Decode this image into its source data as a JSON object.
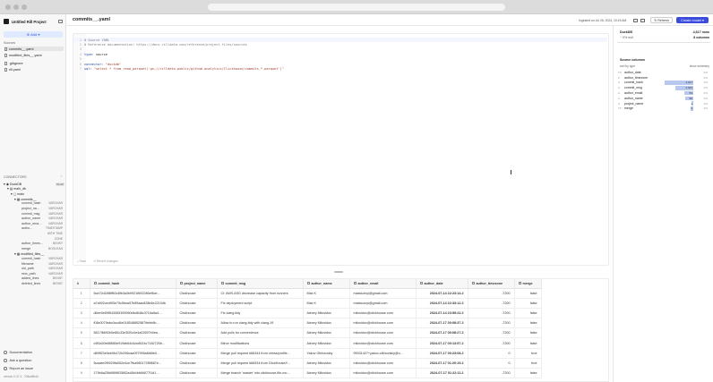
{
  "project": {
    "name": "Untitled Rill Project"
  },
  "sidebar": {
    "add_label": "Add",
    "sources_header": "Sources",
    "files": [
      "commits__.yaml",
      "modified_files__.yaml",
      ".gitignore",
      "rill.yaml"
    ],
    "connectors_header": "CONNECTORS",
    "connector": {
      "name": "DuckDB",
      "badge": "OLAP",
      "database": "main_db",
      "schema": "main"
    },
    "tables": [
      {
        "name": "commits__",
        "columns": [
          {
            "name": "commit_hash",
            "type": "VARCHAR"
          },
          {
            "name": "project_na…",
            "type": "VARCHAR"
          },
          {
            "name": "commit_msg",
            "type": "VARCHAR"
          },
          {
            "name": "author_name",
            "type": "VARCHAR"
          },
          {
            "name": "author_ema…",
            "type": "VARCHAR"
          },
          {
            "name": "autho…",
            "type": "TIMESTAMP"
          },
          {
            "name": "",
            "type": "WITH TIME"
          },
          {
            "name": "",
            "type": "ZONE"
          },
          {
            "name": "author_times…",
            "type": "BIGINT"
          },
          {
            "name": "merge",
            "type": "BOOLEAN"
          }
        ]
      },
      {
        "name": "modified_files__",
        "columns": [
          {
            "name": "commit_hash",
            "type": "VARCHAR"
          },
          {
            "name": "filename",
            "type": "VARCHAR"
          },
          {
            "name": "old_path",
            "type": "VARCHAR"
          },
          {
            "name": "new_path",
            "type": "VARCHAR"
          },
          {
            "name": "added_lines",
            "type": "BIGINT"
          },
          {
            "name": "deleted_lines",
            "type": "BIGINT"
          }
        ]
      }
    ],
    "footer": [
      "Documentation",
      "Ask a question",
      "Report an issue"
    ],
    "version": "version 0.47.4 - 708ad8b4d"
  },
  "header": {
    "title": "commits__.yaml",
    "saved": "Ingested on Jul 26, 2024, 10:15 AM",
    "refresh_label": "Refresh",
    "create_label": "Create model"
  },
  "editor": {
    "lines": [
      {
        "n": "1",
        "parts": [
          {
            "c": "cm",
            "t": "# Source YAML"
          }
        ]
      },
      {
        "n": "2",
        "parts": [
          {
            "c": "cm",
            "t": "# Reference documentation: https://docs.rilldata.com/reference/project-files/sources"
          }
        ]
      },
      {
        "n": "3",
        "parts": []
      },
      {
        "n": "4",
        "parts": [
          {
            "c": "kw",
            "t": "type: "
          },
          {
            "c": "",
            "t": "source"
          }
        ]
      },
      {
        "n": "5",
        "parts": []
      },
      {
        "n": "6",
        "parts": [
          {
            "c": "kw",
            "t": "connector: "
          },
          {
            "c": "str",
            "t": "\"duckdb\""
          }
        ]
      },
      {
        "n": "7",
        "parts": [
          {
            "c": "kw",
            "t": "sql: "
          },
          {
            "c": "str",
            "t": "\"select * from read_parquet('gs://rilldata-public/github-analytics/Clickhouse/commits_*.parquet')\""
          }
        ]
      }
    ],
    "save_label": "Save",
    "revert_label": "Revert changes"
  },
  "table": {
    "columns": [
      "#",
      "commit_hash",
      "project_name",
      "commit_msg",
      "author_name",
      "author_email",
      "author_date",
      "author_timezone",
      "merge"
    ],
    "rows": [
      [
        "1",
        "5ca72d18f8ff63c6fb3a3b9921f692286ef6ce…",
        "Clickhouse",
        "CI: AWS ASG decrease capacity from runners",
        "Max K",
        "maxkuznyi@gmail.com",
        "2024-07-14 22:23:14.2",
        "-7200",
        "false"
      ],
      [
        "2",
        "a7a902ced9f3e75c5bea57b89aac828b6e2210db",
        "Clickhouse",
        "Fix deployment script",
        "Max K",
        "maxkuznyi@gmail.com",
        "2024-07-14 22:33:12.2",
        "-7200",
        "false"
      ],
      [
        "3",
        "d6ee0e59f543065394960dbd648c3716a5a4…",
        "Clickhouse",
        "Fix clang-tidy",
        "Alexey Milovidov",
        "milovidov@clickhouse.com",
        "2024-07-14 23:59:22.2",
        "-7200",
        "false"
      ],
      [
        "4",
        "f08c0079abc0ccd6e0185488925879ebb6b…",
        "Clickhouse",
        "Allow to run clang-tidy with clang-19",
        "Alexey Milovidov",
        "milovidov@clickhouse.com",
        "2024-07-17 00:08:37.2",
        "-7200",
        "false"
      ],
      [
        "5",
        "5817f6692b0e80c33e3f20c0e4a02697b0ea…",
        "Clickhouse",
        "Add pulls for convenience",
        "Alexey Milovidov",
        "milovidov@clickhouse.com",
        "2024-07-17 00:08:27.2",
        "-7200",
        "false"
      ],
      [
        "6",
        "c9f3a30e88580e919db64d1dc8024c7182725b…",
        "Clickhouse",
        "Minor modifications",
        "Alexey Milovidov",
        "milovidov@clickhouse.com",
        "2024-07-17 00:13:57.2",
        "-7200",
        "false"
      ],
      [
        "7",
        "d89ff23e5eb0b472b296caa097995a6b6fe0…",
        "Clickhouse",
        "Merge pull request #66344 from ohriss/profile…",
        "Yakov Olkhovskiy",
        "99031427+yakov-olkhovskiy@u…",
        "2024-07-17 00:23:08.2",
        "0",
        "true"
      ],
      [
        "8",
        "5caaee0f9025fa052e4ce7fba980173f5f887e…",
        "Clickhouse",
        "Merge pull request #66534 from ClickHouse/f…",
        "Alexey Milovidov",
        "milovidov@clickhouse.com",
        "2024-07-17 01:20:15.2",
        "0",
        "true"
      ],
      [
        "9",
        "179b6a25fd9896f25f82a48b4bb6b577f1d1…",
        "Clickhouse",
        "Merge branch 'master' into clickhouse-file-mo…",
        "Alexey Milovidov",
        "milovidov@clickhouse.com",
        "2024-07-17 01:22:11.2",
        "-7200",
        "false"
      ]
    ]
  },
  "inspector": {
    "name": "DuckDB",
    "rows": "4,617 rows",
    "subtitle": "~ 0% null",
    "cols": "8 columns",
    "columns_header": "Source columns",
    "sort_label": "sort by type",
    "show_label": "show summary",
    "profile": [
      {
        "type": "TS",
        "name": "author_date",
        "value": "",
        "pct": 0.0
      },
      {
        "type": "#",
        "name": "author_timezone",
        "value": "",
        "pct": 0.0
      },
      {
        "type": "A",
        "name": "commit_hash",
        "value": "4,617",
        "pct": 1.0
      },
      {
        "type": "A",
        "name": "commit_msg",
        "value": "2,924",
        "pct": 0.63
      },
      {
        "type": "A",
        "name": "author_email",
        "value": "53",
        "pct": 0.3
      },
      {
        "type": "A",
        "name": "author_name",
        "value": "50",
        "pct": 0.28
      },
      {
        "type": "A",
        "name": "project_name",
        "value": "1",
        "pct": 0.05
      },
      {
        "type": "TF",
        "name": "merge",
        "value": "2",
        "pct": 0.08
      }
    ]
  }
}
